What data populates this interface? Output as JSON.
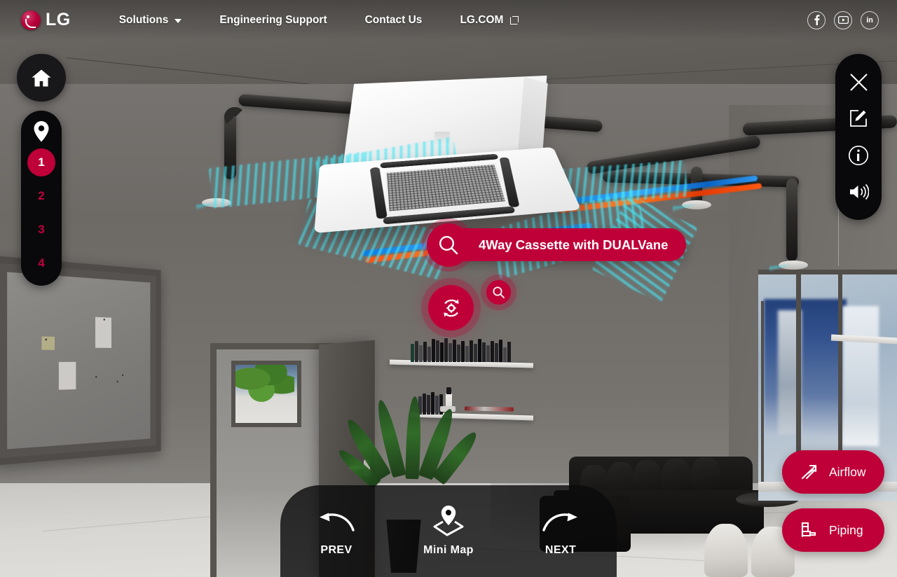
{
  "header": {
    "brand": {
      "name": "LG",
      "icon": "lg-logo-icon"
    },
    "nav": [
      {
        "label": "Solutions",
        "icon": "chevron-down-icon",
        "has_dropdown": true
      },
      {
        "label": "Engineering Support",
        "has_dropdown": false
      },
      {
        "label": "Contact Us",
        "has_dropdown": false
      },
      {
        "label": "LG.COM",
        "icon": "external-link-icon",
        "has_dropdown": false
      }
    ],
    "social": [
      {
        "name": "facebook-icon",
        "glyph": "f"
      },
      {
        "name": "youtube-icon",
        "glyph": "▶"
      },
      {
        "name": "linkedin-icon",
        "glyph": "in"
      }
    ]
  },
  "left_rail": {
    "home": {
      "label": "Home",
      "icon": "home-icon"
    },
    "pin_icon": "location-pin-icon",
    "scenes": [
      {
        "label": "1",
        "active": true
      },
      {
        "label": "2",
        "active": false
      },
      {
        "label": "3",
        "active": false
      },
      {
        "label": "4",
        "active": false
      }
    ]
  },
  "tool_rail": [
    {
      "name": "close-icon",
      "label": "Close"
    },
    {
      "name": "edit-icon",
      "label": "Edit"
    },
    {
      "name": "info-icon",
      "label": "Info"
    },
    {
      "name": "volume-icon",
      "label": "Sound"
    }
  ],
  "hotspots": {
    "primary": {
      "label": "4Way Cassette with DUALVane",
      "icon": "search-icon"
    },
    "rotate": {
      "icon": "rotate-360-icon",
      "label": "360 View"
    },
    "secondary": {
      "icon": "search-icon",
      "label": "Detail"
    }
  },
  "actions": [
    {
      "label": "Airflow",
      "icon": "airflow-icon"
    },
    {
      "label": "Piping",
      "icon": "piping-icon"
    }
  ],
  "bottom_nav": [
    {
      "label": "PREV",
      "icon": "arrow-left-curve-icon"
    },
    {
      "label": "Mini Map",
      "icon": "map-pin-icon"
    },
    {
      "label": "NEXT",
      "icon": "arrow-right-curve-icon"
    }
  ],
  "colors": {
    "brand_crimson": "#BF0038",
    "rail_black": "#09090B",
    "text_white": "#FFFFFF",
    "airflow_cyan": "#3EE2F2",
    "refrigerant_hot": "#FF4A08",
    "refrigerant_cold": "#0B76E0"
  }
}
